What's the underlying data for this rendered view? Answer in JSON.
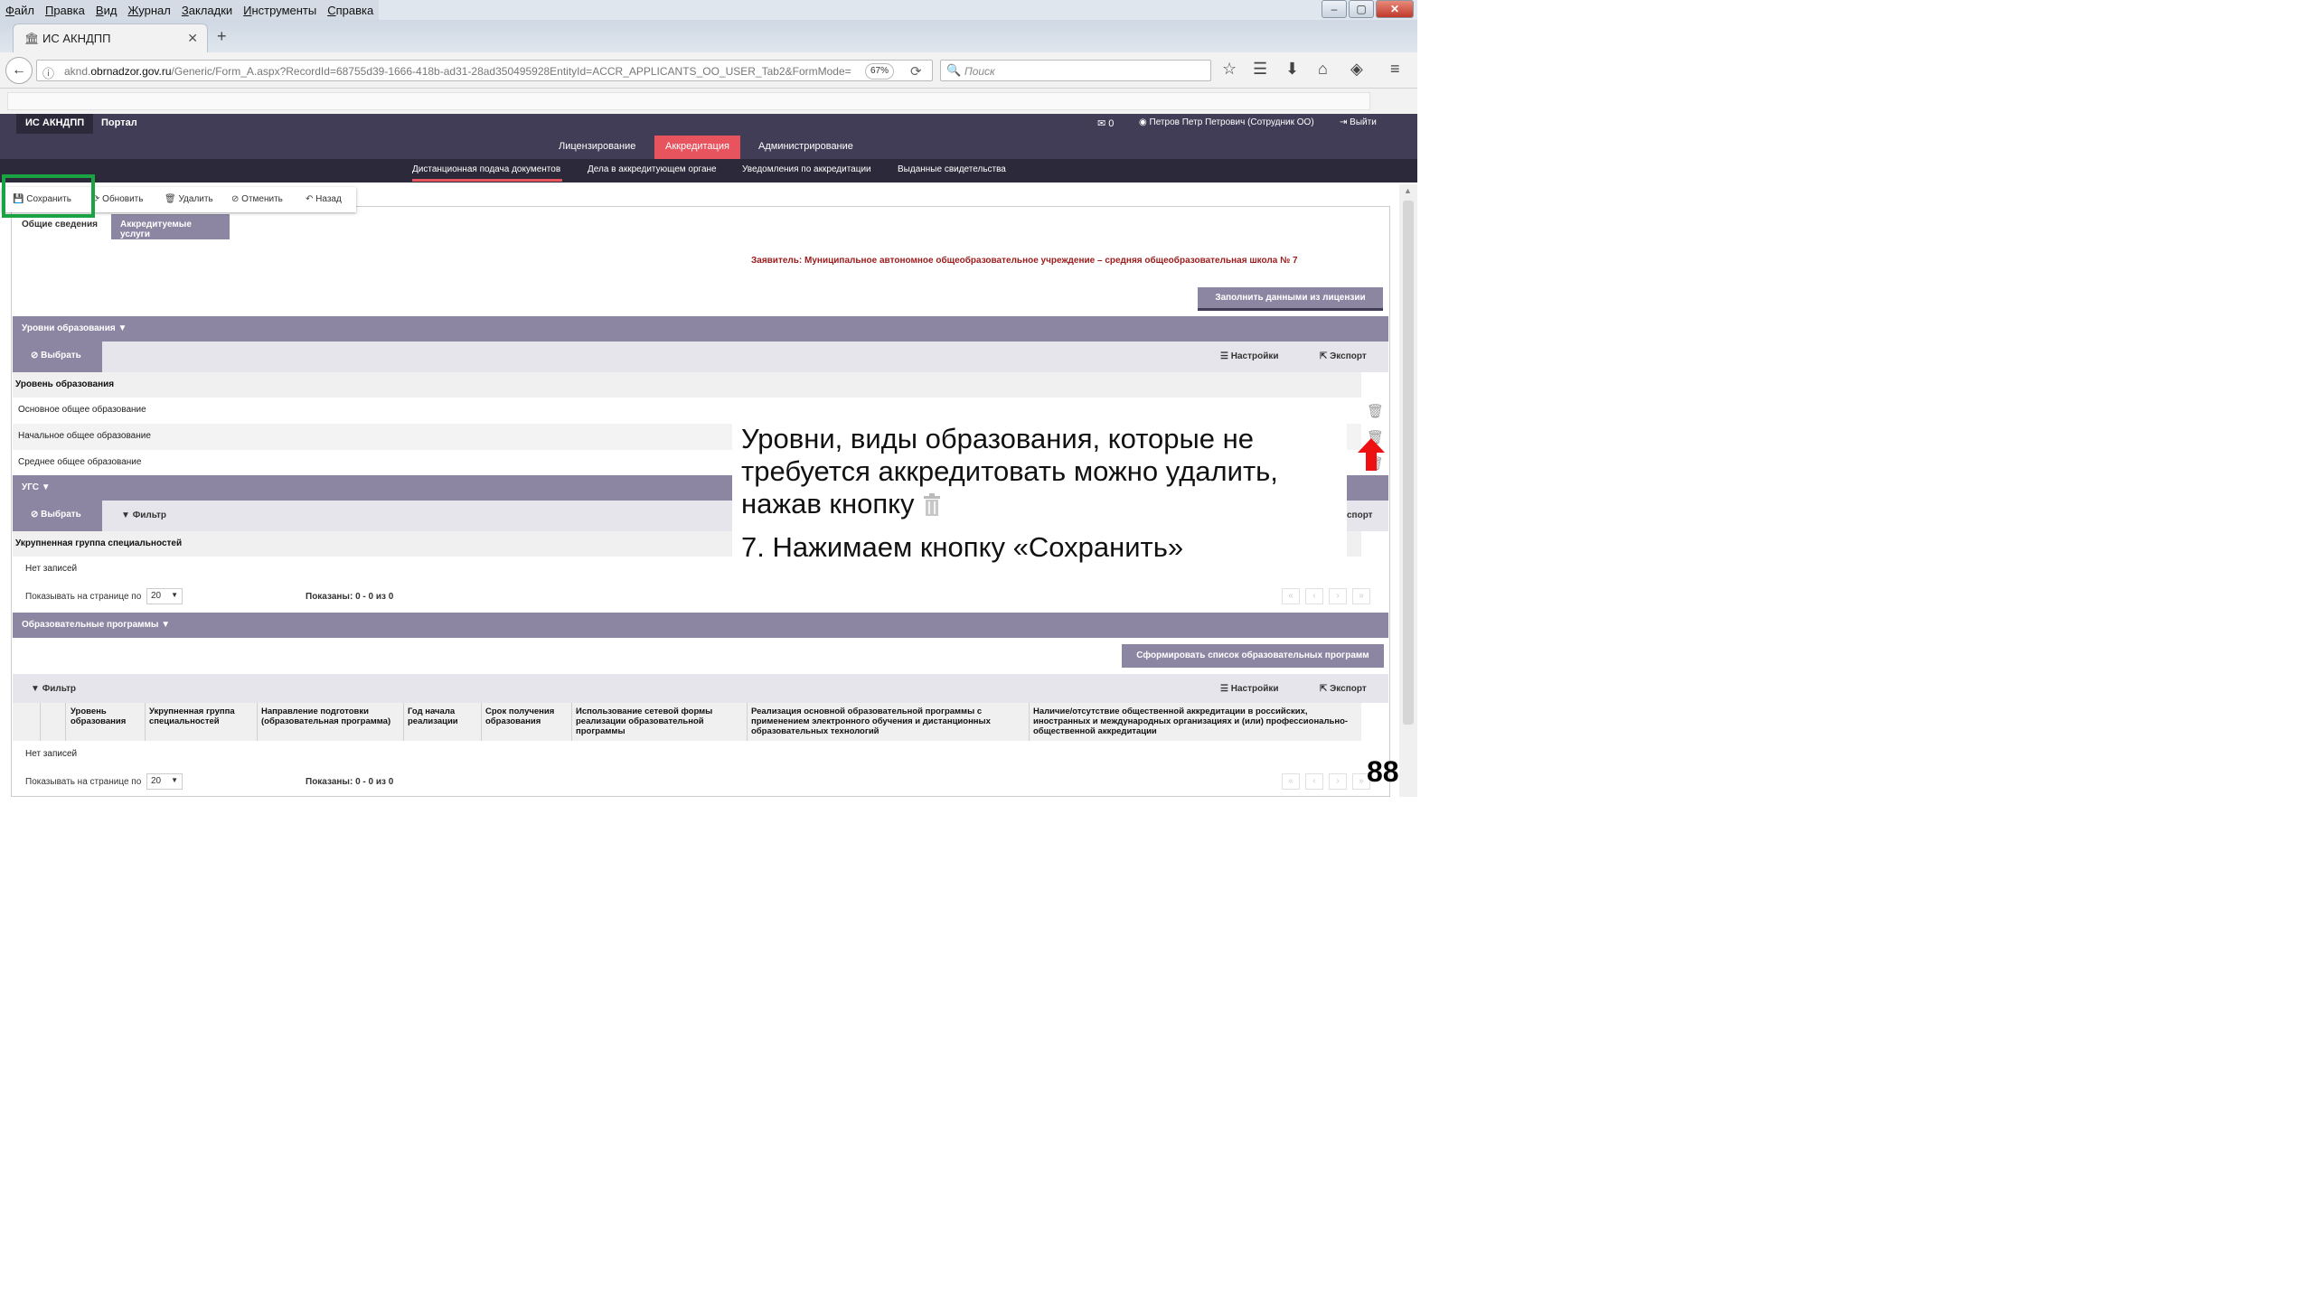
{
  "browser": {
    "menu": [
      "Файл",
      "Правка",
      "Вид",
      "Журнал",
      "Закладки",
      "Инструменты",
      "Справка"
    ],
    "tab_title": "ИС АКНДПП",
    "url_prefix": "aknd.",
    "url_domain": "obrnadzor.gov.ru",
    "url_path": "/Generic/Form_A.aspx?RecordId=68755d39-1666-418b-ad31-28ad350495928EntityId=ACCR_APPLICANTS_OO_USER_Tab2&FormMode=",
    "zoom": "67%",
    "search_placeholder": "Поиск"
  },
  "app": {
    "brand": "ИС АКНДПП",
    "portal": "Портал",
    "mail_count": "0",
    "user": "Петров Петр Петрович (Сотрудник ОО)",
    "logout": "Выйти",
    "main_nav": [
      "Лицензирование",
      "Аккредитация",
      "Администрирование"
    ],
    "sub_nav": [
      "Дистанционная подача документов",
      "Дела в аккредитующем органе",
      "Уведомления по аккредитации",
      "Выданные свидетельства"
    ]
  },
  "toolbar": {
    "save": "Сохранить",
    "refresh": "Обновить",
    "delete": "Удалить",
    "cancel": "Отменить",
    "back": "Назад"
  },
  "form": {
    "tab_general": "Общие сведения",
    "tab_services": "Аккредитуемые услуги",
    "applicant": "Заявитель: Муниципальное автономное общеобразовательное учреждение – средняя общеобразовательная школа № 7",
    "fill_button": "Заполнить данными из лицензии"
  },
  "levels": {
    "header": "Уровни образования",
    "select": "Выбрать",
    "settings": "Настройки",
    "export": "Экспорт",
    "column": "Уровень образования",
    "rows": [
      "Основное общее образование",
      "Начальное общее образование",
      "Среднее общее образование"
    ]
  },
  "ugs": {
    "header": "УГС",
    "select": "Выбрать",
    "filter": "Фильтр",
    "export_partial": "спорт",
    "column": "Укрупненная группа специальностей",
    "empty": "Нет записей",
    "per_page_label": "Показывать на странице по",
    "per_page": "20",
    "shown": "Показаны: 0 - 0 из 0"
  },
  "programs": {
    "header": "Образовательные программы",
    "form_button": "Сформировать список образовательных программ",
    "filter": "Фильтр",
    "settings": "Настройки",
    "export": "Экспорт",
    "columns": [
      "Уровень образования",
      "Укрупненная группа специальностей",
      "Направление подготовки (образовательная программа)",
      "Год начала реализации",
      "Срок получения образования",
      "Использование сетевой формы реализации образовательной программы",
      "Реализация основной образовательной программы с применением электронного обучения и дистанционных образовательных технологий",
      "Наличие/отсутствие общественной аккредитации в российских, иностранных и международных организациях и (или) профессионально-общественной аккредитации"
    ],
    "empty": "Нет записей",
    "per_page_label": "Показывать на странице по",
    "per_page": "20",
    "shown": "Показаны: 0 - 0 из 0"
  },
  "callout": {
    "line1": "Уровни, виды образования, которые не требуется аккредитовать можно удалить, нажав кнопку",
    "line2": "7. Нажимаем кнопку «Сохранить»"
  },
  "slide_number": "88"
}
